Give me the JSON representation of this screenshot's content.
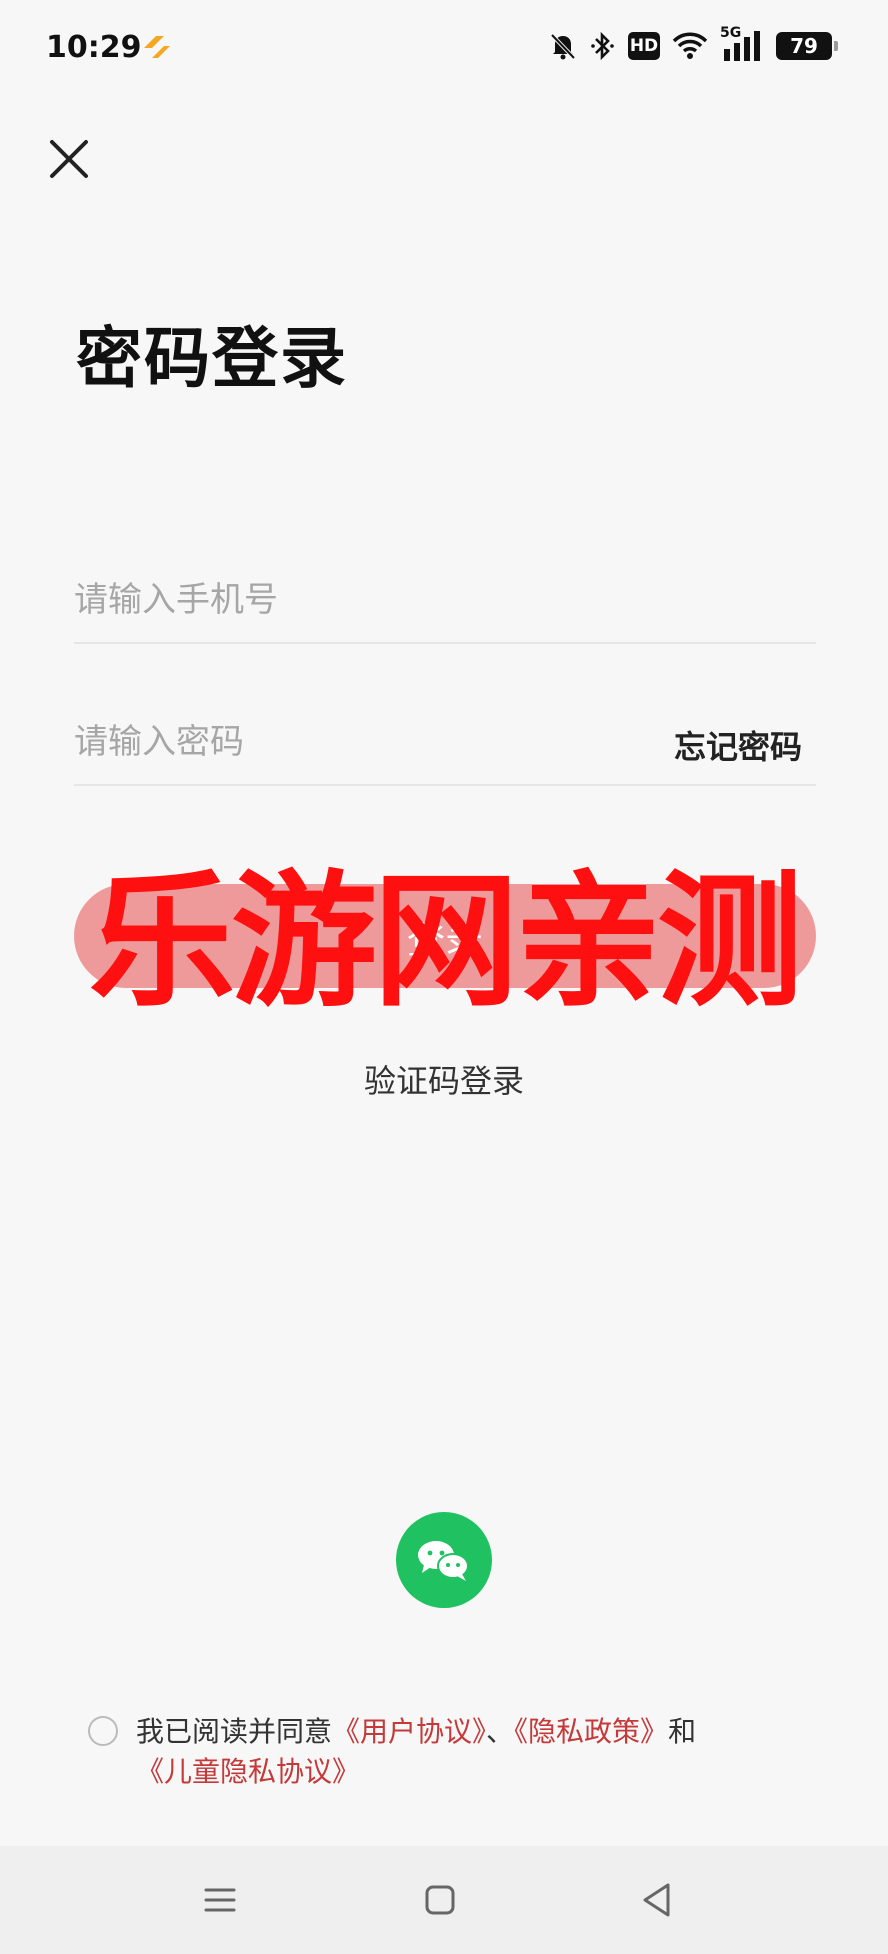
{
  "status_bar": {
    "time": "10:29",
    "hd": "HD",
    "network": "5G",
    "battery": "79"
  },
  "page": {
    "title": "密码登录"
  },
  "phone_field": {
    "placeholder": "请输入手机号"
  },
  "password_field": {
    "placeholder": "请输入密码",
    "forgot_label": "忘记密码"
  },
  "login_button": {
    "label": "登录"
  },
  "watermark": {
    "text": "乐游网亲测"
  },
  "code_login": {
    "label": "验证码登录"
  },
  "wechat": {
    "icon": "wechat-icon",
    "color": "#1fc160"
  },
  "agreement": {
    "prefix": "我已阅读并同意",
    "user_agreement": "《用户协议》",
    "separator": "、",
    "privacy_policy": "《隐私政策》",
    "conjunction": "和",
    "child_privacy": "《儿童隐私协议》",
    "link_color": "#c43a3a"
  },
  "navigation": {
    "menu_icon": "menu-icon",
    "home_icon": "home-square-icon",
    "back_icon": "back-triangle-icon"
  }
}
